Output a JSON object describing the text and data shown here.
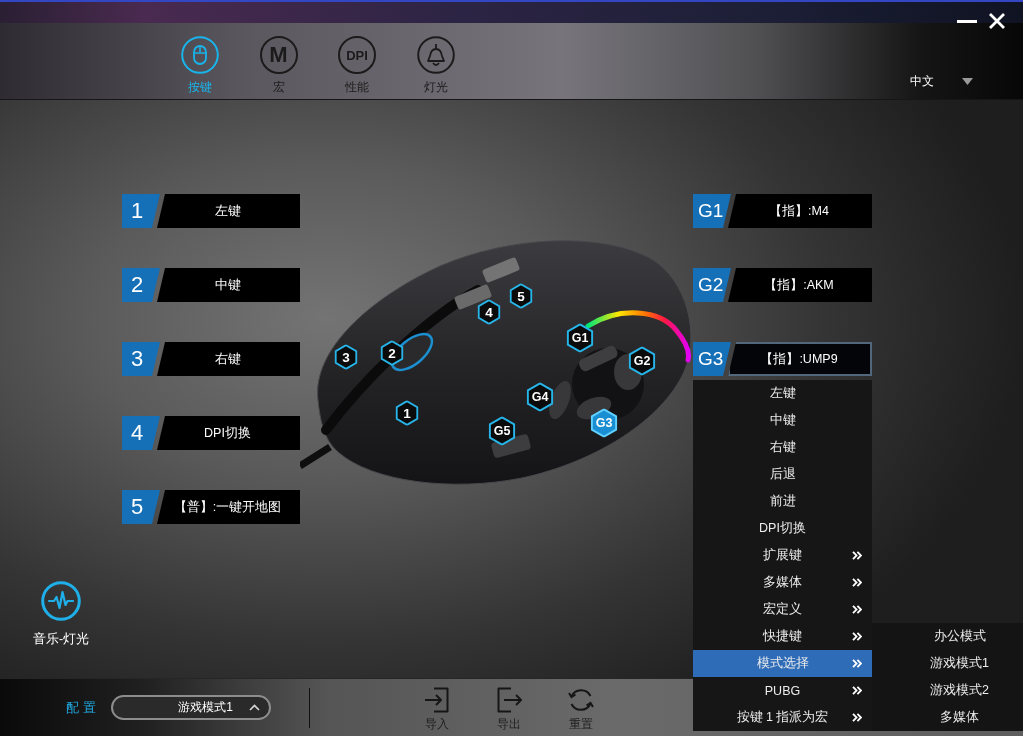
{
  "tabs": [
    {
      "kind": "mouse",
      "label": "按键",
      "selected": true
    },
    {
      "kind": "letters",
      "icon_text": "M",
      "label": "宏",
      "selected": false
    },
    {
      "kind": "letters",
      "icon_text": "DPI",
      "label": "性能",
      "selected": false
    },
    {
      "kind": "lamp",
      "label": "灯光",
      "selected": false
    }
  ],
  "language": {
    "value": "中文"
  },
  "left_buttons": [
    {
      "number": "1",
      "action": "左键",
      "selected": false
    },
    {
      "number": "2",
      "action": "中键",
      "selected": false
    },
    {
      "number": "3",
      "action": "右键",
      "selected": false
    },
    {
      "number": "4",
      "action": "DPI切换",
      "selected": false
    },
    {
      "number": "5",
      "action": "【普】:一键开地图",
      "selected": false
    }
  ],
  "right_buttons": [
    {
      "number": "G1",
      "action": "【指】:M4",
      "selected": false
    },
    {
      "number": "G2",
      "action": "【指】:AKM",
      "selected": false
    },
    {
      "number": "G3",
      "action": "【指】:UMP9",
      "selected": true
    }
  ],
  "hotspots": [
    {
      "label": "1",
      "selected": false
    },
    {
      "label": "2",
      "selected": false
    },
    {
      "label": "3",
      "selected": false
    },
    {
      "label": "4",
      "selected": false
    },
    {
      "label": "5",
      "selected": false
    },
    {
      "label": "G1",
      "selected": false
    },
    {
      "label": "G2",
      "selected": false
    },
    {
      "label": "G3",
      "selected": true
    },
    {
      "label": "G4",
      "selected": false
    },
    {
      "label": "G5",
      "selected": false
    }
  ],
  "context_menu": {
    "items": [
      {
        "label": "左键",
        "has_submenu": false,
        "selected": false
      },
      {
        "label": "中键",
        "has_submenu": false,
        "selected": false
      },
      {
        "label": "右键",
        "has_submenu": false,
        "selected": false
      },
      {
        "label": "后退",
        "has_submenu": false,
        "selected": false
      },
      {
        "label": "前进",
        "has_submenu": false,
        "selected": false
      },
      {
        "label": "DPI切换",
        "has_submenu": false,
        "selected": false
      },
      {
        "label": "扩展键",
        "has_submenu": true,
        "selected": false
      },
      {
        "label": "多媒体",
        "has_submenu": true,
        "selected": false
      },
      {
        "label": "宏定义",
        "has_submenu": true,
        "selected": false
      },
      {
        "label": "快捷键",
        "has_submenu": true,
        "selected": false
      },
      {
        "label": "模式选择",
        "has_submenu": true,
        "selected": true
      },
      {
        "label": "PUBG",
        "has_submenu": true,
        "selected": false
      },
      {
        "label": "按键 1 指派为宏",
        "has_submenu": true,
        "selected": false
      }
    ]
  },
  "submenu": {
    "items": [
      {
        "label": "办公模式",
        "selected": false
      },
      {
        "label": "游戏模式1",
        "selected": false
      },
      {
        "label": "游戏模式2",
        "selected": false
      },
      {
        "label": "多媒体",
        "selected": false
      }
    ]
  },
  "music_light": {
    "label": "音乐-灯光"
  },
  "bottom_bar": {
    "config_label": "配 置",
    "profile": {
      "value": "游戏模式1"
    },
    "actions": [
      {
        "kind": "import",
        "label": "导入"
      },
      {
        "kind": "export",
        "label": "导出"
      },
      {
        "kind": "reset",
        "label": "重置"
      }
    ]
  }
}
